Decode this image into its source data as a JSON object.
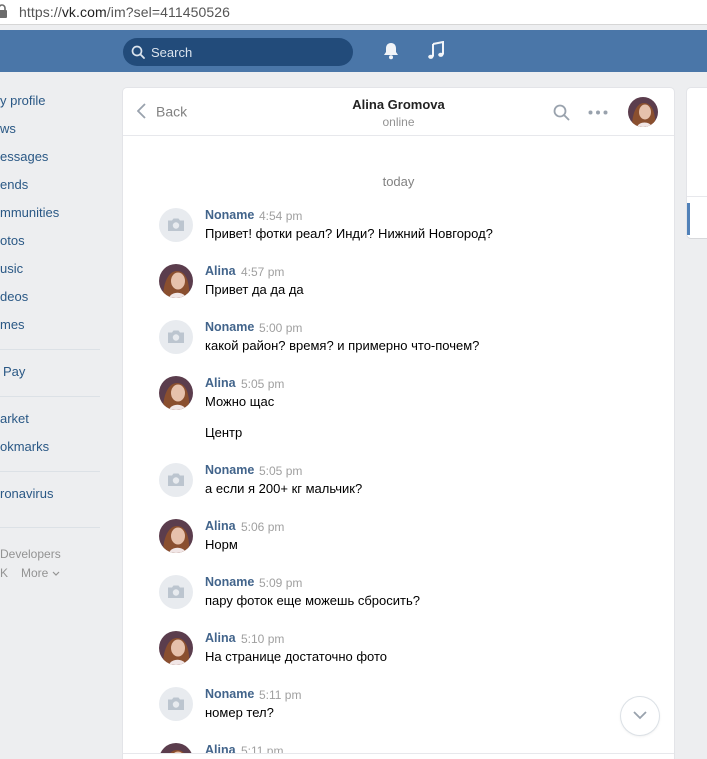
{
  "browser": {
    "url_scheme": "https://",
    "url_host": "vk.com",
    "url_path": "/im?sel=411450526"
  },
  "header": {
    "search_placeholder": "Search",
    "icons": [
      "bell-icon",
      "music-icon"
    ]
  },
  "sidebar": {
    "items": [
      "y profile",
      "ws",
      "essages",
      "ends",
      "mmunities",
      "otos",
      "usic",
      "deos",
      "mes"
    ],
    "pay": "Pay",
    "items2": [
      "arket",
      "okmarks"
    ],
    "items3": [
      "ronavirus"
    ],
    "footer": {
      "developers": "Developers",
      "vk": "K",
      "more": "More"
    }
  },
  "chat": {
    "back_label": "Back",
    "title": "Alina Gromova",
    "status": "online",
    "date_separator": "today",
    "messages": [
      {
        "author": "Noname",
        "time": "4:54 pm",
        "text": "Привет! фотки реал? Инди? Нижний Новгород?"
      },
      {
        "author": "Alina",
        "time": "4:57 pm",
        "text": "Привет да да да"
      },
      {
        "author": "Noname",
        "time": "5:00 pm",
        "text": "какой район? время? и примерно что-почем?"
      },
      {
        "author": "Alina",
        "time": "5:05 pm",
        "text": "Можно щас",
        "text2": "Центр"
      },
      {
        "author": "Noname",
        "time": "5:05 pm",
        "text": "а если я 200+ кг мальчик?"
      },
      {
        "author": "Alina",
        "time": "5:06 pm",
        "text": "Норм"
      },
      {
        "author": "Noname",
        "time": "5:09 pm",
        "text": "пару фоток еще можешь сбросить?"
      },
      {
        "author": "Alina",
        "time": "5:10 pm",
        "text": "На странице достаточно фото"
      },
      {
        "author": "Noname",
        "time": "5:11 pm",
        "text": "номер тел?"
      },
      {
        "author": "Alina",
        "time": "5:11 pm",
        "text": ""
      }
    ]
  },
  "colors": {
    "header": "#4a76a8",
    "link": "#2a5885",
    "author": "#42648b"
  }
}
